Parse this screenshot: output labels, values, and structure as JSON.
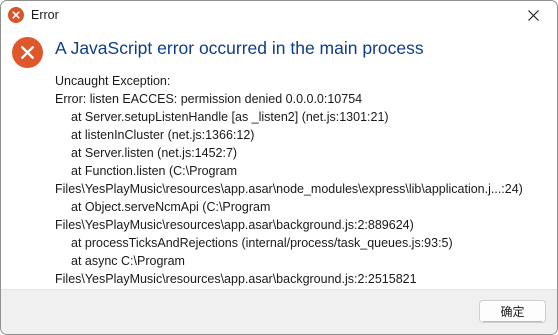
{
  "window": {
    "title": "Error",
    "close_icon": "close-icon",
    "app_icon": "error-icon"
  },
  "dialog": {
    "icon": "error-icon",
    "heading": "A JavaScript error occurred in the main process",
    "message_lines": [
      "Uncaught Exception:",
      "Error: listen EACCES: permission denied 0.0.0.0:10754",
      "at Server.setupListenHandle [as _listen2] (net.js:1301:21)",
      "at listenInCluster (net.js:1366:12)",
      "at Server.listen (net.js:1452:7)",
      "at Function.listen (C:\\Program",
      "Files\\YesPlayMusic\\resources\\app.asar\\node_modules\\express\\lib\\application.j...:24)",
      "at Object.serveNcmApi (C:\\Program",
      "Files\\YesPlayMusic\\resources\\app.asar\\background.js:2:889624)",
      "at processTicksAndRejections (internal/process/task_queues.js:93:5)",
      "at async C:\\Program",
      "Files\\YesPlayMusic\\resources\\app.asar\\background.js:2:2515821"
    ]
  },
  "footer": {
    "ok_label": "确定"
  },
  "colors": {
    "heading": "#0d3e8c",
    "error_icon": "#e0572b",
    "footer_bg": "#f0f0f0"
  }
}
